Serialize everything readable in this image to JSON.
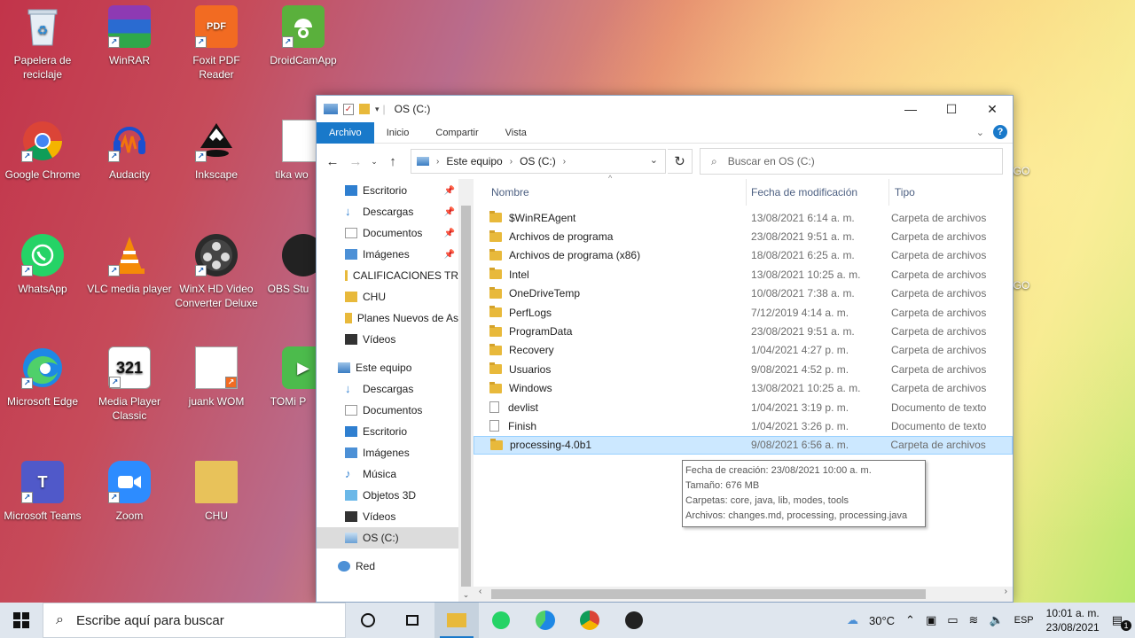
{
  "desktop": {
    "icons": [
      {
        "label": "Papelera de reciclaje",
        "icon": "recycle-bin-icon"
      },
      {
        "label": "WinRAR",
        "icon": "winrar-icon"
      },
      {
        "label": "Foxit PDF Reader",
        "icon": "foxit-icon",
        "badge": "PDF"
      },
      {
        "label": "DroidCamApp",
        "icon": "droidcam-icon"
      },
      {
        "label": "Google Chrome",
        "icon": "chrome-icon"
      },
      {
        "label": "Audacity",
        "icon": "audacity-icon"
      },
      {
        "label": "Inkscape",
        "icon": "inkscape-icon"
      },
      {
        "label": "tika wo",
        "icon": "document-icon"
      },
      {
        "label": "WhatsApp",
        "icon": "whatsapp-icon"
      },
      {
        "label": "VLC media player",
        "icon": "vlc-icon"
      },
      {
        "label": "WinX HD Video Converter Deluxe",
        "icon": "winx-icon"
      },
      {
        "label": "OBS Stu",
        "icon": "obs-icon"
      },
      {
        "label": "Microsoft Edge",
        "icon": "edge-icon"
      },
      {
        "label": "Media Player Classic",
        "icon": "mpc-icon",
        "badge": "321"
      },
      {
        "label": "juank WOM",
        "icon": "document-icon"
      },
      {
        "label": "TOMi P",
        "icon": "media-icon"
      },
      {
        "label": "Microsoft Teams",
        "icon": "teams-icon"
      },
      {
        "label": "Zoom",
        "icon": "zoom-icon"
      },
      {
        "label": "CHU",
        "icon": "folder-icon"
      }
    ],
    "right_labels": [
      "AGO",
      "AGO"
    ]
  },
  "explorer": {
    "title": "OS (C:)",
    "ribbon_tabs": [
      "Archivo",
      "Inicio",
      "Compartir",
      "Vista"
    ],
    "address": {
      "parts": [
        "Este equipo",
        "OS (C:)"
      ]
    },
    "search_placeholder": "Buscar en OS (C:)",
    "nav": {
      "quick_access": [
        {
          "label": "Escritorio",
          "icon": "desktop-icon",
          "pinned": true
        },
        {
          "label": "Descargas",
          "icon": "download-icon",
          "pinned": true
        },
        {
          "label": "Documentos",
          "icon": "documents-icon",
          "pinned": true
        },
        {
          "label": "Imágenes",
          "icon": "pictures-icon",
          "pinned": true
        },
        {
          "label": "CALIFICACIONES TR",
          "icon": "folder-icon",
          "pinned": false
        },
        {
          "label": "CHU",
          "icon": "folder-icon",
          "pinned": false
        },
        {
          "label": "Planes Nuevos de As",
          "icon": "folder-icon",
          "pinned": false
        },
        {
          "label": "Vídeos",
          "icon": "videos-icon",
          "pinned": false
        }
      ],
      "this_pc": "Este equipo",
      "this_pc_items": [
        {
          "label": "Descargas",
          "icon": "download-icon"
        },
        {
          "label": "Documentos",
          "icon": "documents-icon"
        },
        {
          "label": "Escritorio",
          "icon": "desktop-icon"
        },
        {
          "label": "Imágenes",
          "icon": "pictures-icon"
        },
        {
          "label": "Música",
          "icon": "music-icon"
        },
        {
          "label": "Objetos 3D",
          "icon": "3d-objects-icon"
        },
        {
          "label": "Vídeos",
          "icon": "videos-icon"
        },
        {
          "label": "OS (C:)",
          "icon": "drive-icon"
        }
      ],
      "network": "Red"
    },
    "columns": [
      "Nombre",
      "Fecha de modificación",
      "Tipo"
    ],
    "files": [
      {
        "name": "$WinREAgent",
        "date": "13/08/2021 6:14 a. m.",
        "type": "Carpeta de archivos",
        "kind": "folder"
      },
      {
        "name": "Archivos de programa",
        "date": "23/08/2021 9:51 a. m.",
        "type": "Carpeta de archivos",
        "kind": "folder"
      },
      {
        "name": "Archivos de programa (x86)",
        "date": "18/08/2021 6:25 a. m.",
        "type": "Carpeta de archivos",
        "kind": "folder"
      },
      {
        "name": "Intel",
        "date": "13/08/2021 10:25 a. m.",
        "type": "Carpeta de archivos",
        "kind": "folder"
      },
      {
        "name": "OneDriveTemp",
        "date": "10/08/2021 7:38 a. m.",
        "type": "Carpeta de archivos",
        "kind": "folder"
      },
      {
        "name": "PerfLogs",
        "date": "7/12/2019 4:14 a. m.",
        "type": "Carpeta de archivos",
        "kind": "folder"
      },
      {
        "name": "ProgramData",
        "date": "23/08/2021 9:51 a. m.",
        "type": "Carpeta de archivos",
        "kind": "folder"
      },
      {
        "name": "Recovery",
        "date": "1/04/2021 4:27 p. m.",
        "type": "Carpeta de archivos",
        "kind": "folder"
      },
      {
        "name": "Usuarios",
        "date": "9/08/2021 4:52 p. m.",
        "type": "Carpeta de archivos",
        "kind": "folder"
      },
      {
        "name": "Windows",
        "date": "13/08/2021 10:25 a. m.",
        "type": "Carpeta de archivos",
        "kind": "folder"
      },
      {
        "name": "devlist",
        "date": "1/04/2021 3:19 p. m.",
        "type": "Documento de texto",
        "kind": "file"
      },
      {
        "name": "Finish",
        "date": "1/04/2021 3:26 p. m.",
        "type": "Documento de texto",
        "kind": "file"
      },
      {
        "name": "processing-4.0b1",
        "date": "9/08/2021 6:56 a. m.",
        "type": "Carpeta de archivos",
        "kind": "folder",
        "selected": true
      }
    ],
    "tooltip": [
      "Fecha de creación: 23/08/2021 10:00 a. m.",
      "Tamaño: 676 MB",
      "Carpetas: core, java, lib, modes, tools",
      "Archivos: changes.md, processing, processing.java"
    ]
  },
  "taskbar": {
    "search_placeholder": "Escribe aquí para buscar",
    "apps": [
      "cortana-icon",
      "task-view-icon",
      "file-explorer-icon",
      "whatsapp-icon",
      "edge-icon",
      "chrome-icon",
      "inkscape-icon"
    ],
    "temperature": "30°C",
    "language": "ESP",
    "time": "10:01 a. m.",
    "date": "23/08/2021",
    "notifications": "1"
  }
}
